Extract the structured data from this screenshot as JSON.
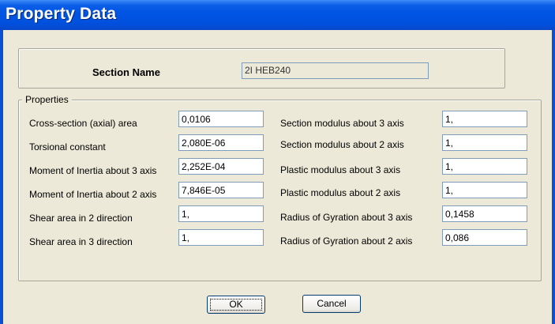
{
  "window": {
    "title": "Property Data"
  },
  "section": {
    "label": "Section Name",
    "value": "2I HEB240"
  },
  "properties": {
    "group_label": "Properties",
    "left": [
      {
        "label": "Cross-section (axial) area",
        "value": "0,0106"
      },
      {
        "label": "Torsional constant",
        "value": "2,080E-06"
      },
      {
        "label": "Moment of Inertia about 3 axis",
        "value": "2,252E-04"
      },
      {
        "label": "Moment of Inertia about 2 axis",
        "value": "7,846E-05"
      },
      {
        "label": "Shear area in 2 direction",
        "value": "1,"
      },
      {
        "label": "Shear area in 3 direction",
        "value": "1,"
      }
    ],
    "right": [
      {
        "label": "Section modulus about 3 axis",
        "value": "1,"
      },
      {
        "label": "Section modulus about 2 axis",
        "value": "1,"
      },
      {
        "label": "Plastic modulus about 3 axis",
        "value": "1,"
      },
      {
        "label": "Plastic modulus about 2 axis",
        "value": "1,"
      },
      {
        "label": "Radius of Gyration about 3 axis",
        "value": "0,1458"
      },
      {
        "label": "Radius of Gyration about 2 axis",
        "value": "0,086"
      }
    ]
  },
  "buttons": {
    "ok": "OK",
    "cancel": "Cancel"
  },
  "colors": {
    "titlebar": "#0054e3",
    "dialog_bg": "#ece9d8",
    "input_border": "#7f9db9"
  }
}
